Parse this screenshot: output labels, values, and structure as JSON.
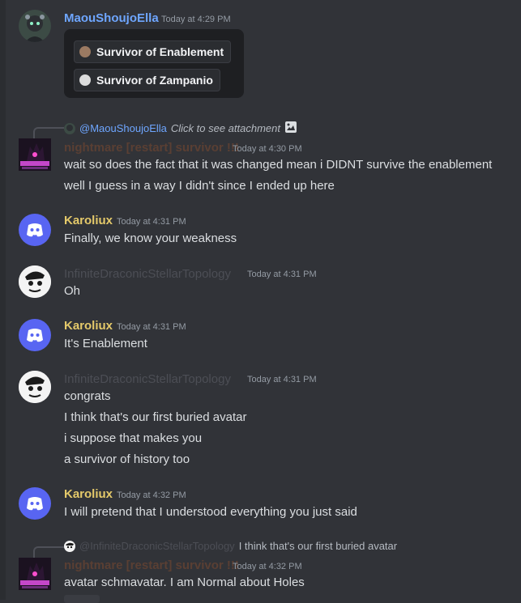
{
  "colors": {
    "background": "#313338",
    "blue_name": "#6ea6ff",
    "gold_name": "#e4c96a",
    "dim_name": "#4c4e55",
    "pink_name": "#5a3f33",
    "discord_blurple": "#5865f2"
  },
  "messages": [
    {
      "author": "MaouShoujoElla",
      "timestamp": "Today at 4:29 PM",
      "roles": [
        {
          "label": "Survivor of Enablement",
          "dot_color": "#9b7a62"
        },
        {
          "label": "Survivor of Zampanio",
          "dot_color": "#dcdcdc"
        }
      ]
    },
    {
      "reply": {
        "mention": "@MaouShoujoElla",
        "text": "Click to see attachment",
        "icon": "image-icon"
      },
      "author": "nightmare [restart] survivor !!!",
      "timestamp": "Today at 4:30 PM",
      "lines": [
        "wait so does the fact that it was changed mean i DIDNT survive the enablement",
        "well I guess in a way I didn't since I ended up here"
      ]
    },
    {
      "author": "Karoliux",
      "timestamp": "Today at 4:31 PM",
      "lines": [
        "Finally, we know your weakness"
      ]
    },
    {
      "author": "InfiniteDraconicStellarTopology",
      "timestamp": "Today at 4:31 PM",
      "lines": [
        "Oh"
      ]
    },
    {
      "author": "Karoliux",
      "timestamp": "Today at 4:31 PM",
      "lines": [
        "It's Enablement"
      ]
    },
    {
      "author": "InfiniteDraconicStellarTopology",
      "timestamp": "Today at 4:31 PM",
      "lines": [
        "congrats",
        "I think that's our first buried avatar",
        "i suppose that makes you",
        "a survivor of history too"
      ]
    },
    {
      "author": "Karoliux",
      "timestamp": "Today at 4:32 PM",
      "lines": [
        "I will pretend that I understood everything you just said"
      ]
    },
    {
      "reply": {
        "mention": "@InfiniteDraconicStellarTopology",
        "text": "I think that's our first buried avatar"
      },
      "author": "nightmare [restart] survivor !!!",
      "timestamp": "Today at 4:32 PM",
      "lines": [
        "avatar schmavatar. I am Normal about Holes"
      ]
    }
  ]
}
